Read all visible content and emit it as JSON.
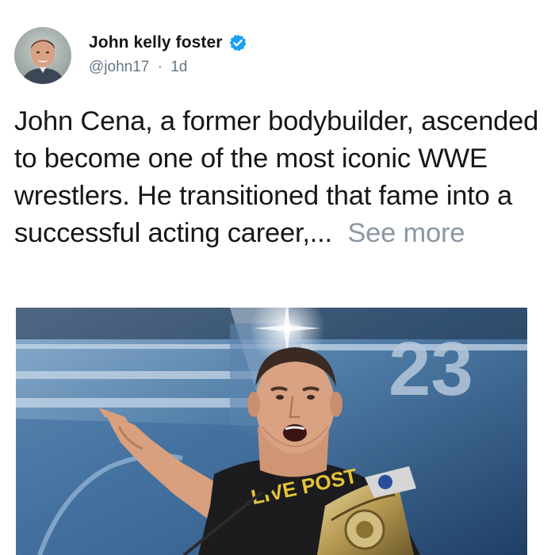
{
  "post": {
    "author": {
      "display_name": "John kelly foster",
      "handle": "@john17",
      "separator": "·",
      "timestamp": "1d",
      "verified": true
    },
    "text": "John Cena, a former bodybuilder, ascended to become one of the most iconic WWE wrestlers. He transitioned that fame into a successful acting career,...",
    "see_more_label": "See more",
    "media": {
      "backdrop_number": "23",
      "shirt_text": "LIVE POST"
    }
  },
  "colors": {
    "verified_blue": "#1da1f2",
    "handle_gray": "#657786",
    "text_dark": "#14171a",
    "see_more_gray": "#8a98a4"
  },
  "icons": {
    "verified": "verified-badge-icon"
  }
}
